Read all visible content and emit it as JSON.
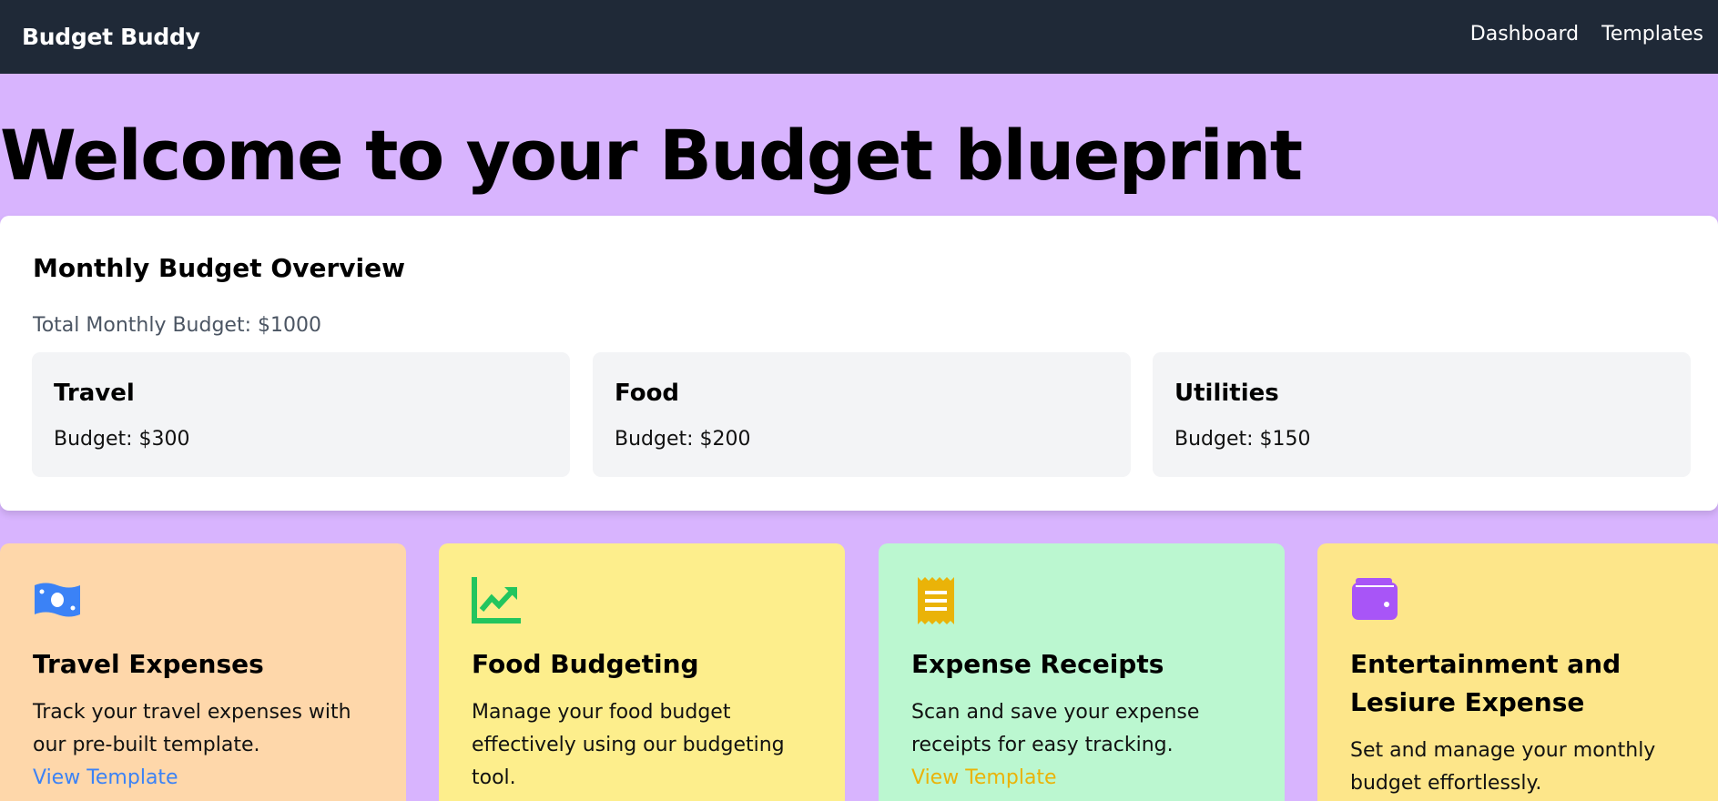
{
  "navbar": {
    "brand": "Budget Buddy",
    "links": [
      "Dashboard",
      "Templates"
    ]
  },
  "hero": {
    "title": "Welcome to your Budget blueprint"
  },
  "overview": {
    "title": "Monthly Budget Overview",
    "total": "Total Monthly Budget: $1000",
    "categories": [
      {
        "name": "Travel",
        "budget": "Budget: $300"
      },
      {
        "name": "Food",
        "budget": "Budget: $200"
      },
      {
        "name": "Utilities",
        "budget": "Budget: $150"
      }
    ]
  },
  "templates": [
    {
      "icon": "money-bill-icon",
      "title": "Travel Expenses",
      "description": "Track your travel expenses with our pre-built template.",
      "link": "View Template",
      "bg": "#fed7aa",
      "accent": "#3b82f6"
    },
    {
      "icon": "chart-line-icon",
      "title": "Food Budgeting",
      "description": "Manage your food budget effectively using our budgeting tool.",
      "bg": "#fdee8c",
      "accent": "#22c55e"
    },
    {
      "icon": "receipt-icon",
      "title": "Expense Receipts",
      "description": "Scan and save your expense receipts for easy tracking.",
      "link": "View Template",
      "bg": "#bbf7d0",
      "accent": "#eab308"
    },
    {
      "icon": "wallet-icon",
      "title": "Entertainment and Lesiure Expense",
      "description": "Set and manage your monthly budget effortlessly.",
      "bg": "#fde68a",
      "accent": "#a855f7"
    }
  ]
}
